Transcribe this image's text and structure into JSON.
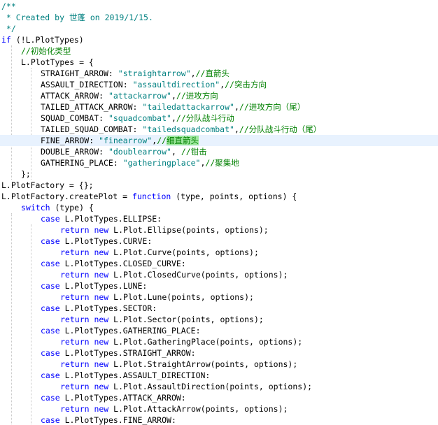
{
  "editor": {
    "highlighted_line": 12,
    "lines": [
      {
        "indent": 0,
        "tokens": [
          {
            "t": "/**",
            "c": "doc"
          }
        ]
      },
      {
        "indent": 0,
        "tokens": [
          {
            "t": " * Created by ",
            "c": "doc"
          },
          {
            "t": "世蓬",
            "c": "doc cjk"
          },
          {
            "t": " on 2019/1/15.",
            "c": "doc"
          }
        ]
      },
      {
        "indent": 0,
        "tokens": [
          {
            "t": " */",
            "c": "doc"
          }
        ]
      },
      {
        "indent": 0,
        "tokens": [
          {
            "t": "if",
            "c": "kw"
          },
          {
            "t": " (!L.PlotTypes)",
            "c": "plain"
          }
        ]
      },
      {
        "indent": 1,
        "tokens": [
          {
            "t": "//",
            "c": "cmt"
          },
          {
            "t": "初始化类型",
            "c": "cmt cjk"
          }
        ]
      },
      {
        "indent": 1,
        "tokens": [
          {
            "t": "L.PlotTypes = {",
            "c": "plain"
          }
        ]
      },
      {
        "indent": 2,
        "tokens": [
          {
            "t": "STRAIGHT_ARROW: ",
            "c": "plain"
          },
          {
            "t": "\"straightarrow\"",
            "c": "str"
          },
          {
            "t": ",",
            "c": "plain"
          },
          {
            "t": "//",
            "c": "cmt"
          },
          {
            "t": "直箭头",
            "c": "cmt cjk"
          }
        ]
      },
      {
        "indent": 2,
        "tokens": [
          {
            "t": "ASSAULT_DIRECTION: ",
            "c": "plain"
          },
          {
            "t": "\"assaultdirection\"",
            "c": "str"
          },
          {
            "t": ",",
            "c": "plain"
          },
          {
            "t": "//",
            "c": "cmt"
          },
          {
            "t": "突击方向",
            "c": "cmt cjk"
          }
        ]
      },
      {
        "indent": 2,
        "tokens": [
          {
            "t": "ATTACK_ARROW: ",
            "c": "plain"
          },
          {
            "t": "\"attackarrow\"",
            "c": "str"
          },
          {
            "t": ",",
            "c": "plain"
          },
          {
            "t": "//",
            "c": "cmt"
          },
          {
            "t": "进攻方向",
            "c": "cmt cjk"
          }
        ]
      },
      {
        "indent": 2,
        "tokens": [
          {
            "t": "TAILED_ATTACK_ARROW: ",
            "c": "plain"
          },
          {
            "t": "\"tailedattackarrow\"",
            "c": "str"
          },
          {
            "t": ",",
            "c": "plain"
          },
          {
            "t": "//",
            "c": "cmt"
          },
          {
            "t": "进攻方向（尾）",
            "c": "cmt cjk"
          }
        ]
      },
      {
        "indent": 2,
        "tokens": [
          {
            "t": "SQUAD_COMBAT: ",
            "c": "plain"
          },
          {
            "t": "\"squadcombat\"",
            "c": "str"
          },
          {
            "t": ",",
            "c": "plain"
          },
          {
            "t": "//",
            "c": "cmt"
          },
          {
            "t": "分队战斗行动",
            "c": "cmt cjk"
          }
        ]
      },
      {
        "indent": 2,
        "tokens": [
          {
            "t": "TAILED_SQUAD_COMBAT: ",
            "c": "plain"
          },
          {
            "t": "\"tailedsquadcombat\"",
            "c": "str"
          },
          {
            "t": ",",
            "c": "plain"
          },
          {
            "t": "//",
            "c": "cmt"
          },
          {
            "t": "分队战斗行动（尾）",
            "c": "cmt cjk"
          }
        ]
      },
      {
        "indent": 2,
        "tokens": [
          {
            "t": "FINE_ARROW: ",
            "c": "plain"
          },
          {
            "t": "\"finearrow\"",
            "c": "str"
          },
          {
            "t": ",",
            "c": "plain"
          },
          {
            "t": "//",
            "c": "cmt"
          },
          {
            "t": "细直箭头",
            "c": "match cjk"
          }
        ]
      },
      {
        "indent": 2,
        "tokens": [
          {
            "t": "DOUBLE_ARROW: ",
            "c": "plain"
          },
          {
            "t": "\"doublearrow\"",
            "c": "str"
          },
          {
            "t": ", ",
            "c": "plain"
          },
          {
            "t": "//",
            "c": "cmt"
          },
          {
            "t": "钳击",
            "c": "cmt cjk"
          }
        ]
      },
      {
        "indent": 2,
        "tokens": [
          {
            "t": "GATHERING_PLACE: ",
            "c": "plain"
          },
          {
            "t": "\"gatheringplace\"",
            "c": "str"
          },
          {
            "t": ",",
            "c": "plain"
          },
          {
            "t": "//",
            "c": "cmt"
          },
          {
            "t": "聚集地",
            "c": "cmt cjk"
          }
        ]
      },
      {
        "indent": 1,
        "tokens": [
          {
            "t": "};",
            "c": "plain"
          }
        ]
      },
      {
        "indent": 0,
        "tokens": [
          {
            "t": "L.PlotFactory = {};",
            "c": "plain"
          }
        ]
      },
      {
        "indent": 0,
        "tokens": [
          {
            "t": "L.PlotFactory.createPlot = ",
            "c": "plain"
          },
          {
            "t": "function",
            "c": "kw"
          },
          {
            "t": " (type, points, options) {",
            "c": "plain"
          }
        ]
      },
      {
        "indent": 1,
        "tokens": [
          {
            "t": "switch",
            "c": "kw"
          },
          {
            "t": " (type) {",
            "c": "plain"
          }
        ]
      },
      {
        "indent": 2,
        "tokens": [
          {
            "t": "case",
            "c": "kw"
          },
          {
            "t": " L.PlotTypes.ELLIPSE:",
            "c": "plain"
          }
        ]
      },
      {
        "indent": 3,
        "tokens": [
          {
            "t": "return new",
            "c": "kw"
          },
          {
            "t": " L.Plot.Ellipse(points, options);",
            "c": "plain"
          }
        ]
      },
      {
        "indent": 2,
        "tokens": [
          {
            "t": "case",
            "c": "kw"
          },
          {
            "t": " L.PlotTypes.CURVE:",
            "c": "plain"
          }
        ]
      },
      {
        "indent": 3,
        "tokens": [
          {
            "t": "return new",
            "c": "kw"
          },
          {
            "t": " L.Plot.Curve(points, options);",
            "c": "plain"
          }
        ]
      },
      {
        "indent": 2,
        "tokens": [
          {
            "t": "case",
            "c": "kw"
          },
          {
            "t": " L.PlotTypes.CLOSED_CURVE:",
            "c": "plain"
          }
        ]
      },
      {
        "indent": 3,
        "tokens": [
          {
            "t": "return new",
            "c": "kw"
          },
          {
            "t": " L.Plot.ClosedCurve(points, options);",
            "c": "plain"
          }
        ]
      },
      {
        "indent": 2,
        "tokens": [
          {
            "t": "case",
            "c": "kw"
          },
          {
            "t": " L.PlotTypes.LUNE:",
            "c": "plain"
          }
        ]
      },
      {
        "indent": 3,
        "tokens": [
          {
            "t": "return new",
            "c": "kw"
          },
          {
            "t": " L.Plot.Lune(points, options);",
            "c": "plain"
          }
        ]
      },
      {
        "indent": 2,
        "tokens": [
          {
            "t": "case",
            "c": "kw"
          },
          {
            "t": " L.PlotTypes.SECTOR:",
            "c": "plain"
          }
        ]
      },
      {
        "indent": 3,
        "tokens": [
          {
            "t": "return new",
            "c": "kw"
          },
          {
            "t": " L.Plot.Sector(points, options);",
            "c": "plain"
          }
        ]
      },
      {
        "indent": 2,
        "tokens": [
          {
            "t": "case",
            "c": "kw"
          },
          {
            "t": " L.PlotTypes.GATHERING_PLACE:",
            "c": "plain"
          }
        ]
      },
      {
        "indent": 3,
        "tokens": [
          {
            "t": "return new",
            "c": "kw"
          },
          {
            "t": " L.Plot.GatheringPlace(points, options);",
            "c": "plain"
          }
        ]
      },
      {
        "indent": 2,
        "tokens": [
          {
            "t": "case",
            "c": "kw"
          },
          {
            "t": " L.PlotTypes.STRAIGHT_ARROW:",
            "c": "plain"
          }
        ]
      },
      {
        "indent": 3,
        "tokens": [
          {
            "t": "return new",
            "c": "kw"
          },
          {
            "t": " L.Plot.StraightArrow(points, options);",
            "c": "plain"
          }
        ]
      },
      {
        "indent": 2,
        "tokens": [
          {
            "t": "case",
            "c": "kw"
          },
          {
            "t": " L.PlotTypes.ASSAULT_DIRECTION:",
            "c": "plain"
          }
        ]
      },
      {
        "indent": 3,
        "tokens": [
          {
            "t": "return new",
            "c": "kw"
          },
          {
            "t": " L.Plot.AssaultDirection(points, options);",
            "c": "plain"
          }
        ]
      },
      {
        "indent": 2,
        "tokens": [
          {
            "t": "case",
            "c": "kw"
          },
          {
            "t": " L.PlotTypes.ATTACK_ARROW:",
            "c": "plain"
          }
        ]
      },
      {
        "indent": 3,
        "tokens": [
          {
            "t": "return new",
            "c": "kw"
          },
          {
            "t": " L.Plot.AttackArrow(points, options);",
            "c": "plain"
          }
        ]
      },
      {
        "indent": 2,
        "tokens": [
          {
            "t": "case",
            "c": "kw"
          },
          {
            "t": " L.PlotTypes.FINE_ARROW:",
            "c": "plain"
          }
        ]
      }
    ]
  }
}
